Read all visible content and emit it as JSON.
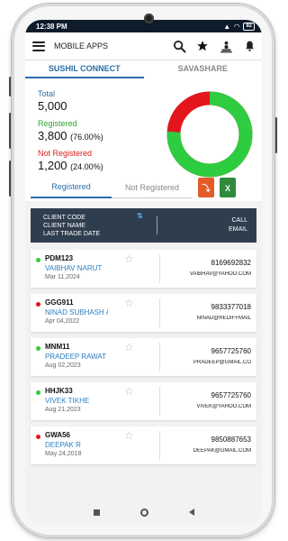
{
  "status": {
    "time": "12:38 PM",
    "battery": "92"
  },
  "app": {
    "title": "MOBILE APPS"
  },
  "icons": [
    "menu-icon",
    "search-icon",
    "star-icon",
    "trophy-icon",
    "bell-icon"
  ],
  "tabs": [
    {
      "label": "SUSHIL CONNECT",
      "active": true
    },
    {
      "label": "SAVASHARE",
      "active": false
    }
  ],
  "summary": {
    "total_label": "Total",
    "total": "5,000",
    "registered_label": "Registered",
    "registered": "3,800",
    "registered_pct": "(76.00%)",
    "not_registered_label": "Not Registered",
    "not_registered": "1,200",
    "not_registered_pct": "(24.00%)",
    "registered_fraction": 0.76
  },
  "colors": {
    "registered": "#2ecc40",
    "not_registered": "#e3161d",
    "accent": "#2a6ea8",
    "header": "#2f3e4e"
  },
  "filters": {
    "registered": "Registered",
    "not_registered": "Not Registered"
  },
  "table": {
    "head_left": [
      "CLIENT CODE",
      "CLIENT NAME",
      "LAST TRADE DATE"
    ],
    "head_right": [
      "CALL",
      "EMAIL"
    ]
  },
  "clients": [
    {
      "code": "PDM123",
      "name": "VAIBHAV NARUT",
      "date": "Mar 11,2024",
      "phone": "8169692832",
      "email": "VAIBHAV@YAHOO.COM",
      "status": "registered"
    },
    {
      "code": "GGG911",
      "name": "NINAD SUBHASH AT",
      "date": "Apr 04,2022",
      "phone": "9833377018",
      "email": "NINAD@REDIFFMAIL",
      "status": "not_registered"
    },
    {
      "code": "MNM11",
      "name": "PRADEEP RAWAT",
      "date": "Aug 02,2023",
      "phone": "9657725760",
      "email": "PRADEEP@GMAIL.CO",
      "status": "registered"
    },
    {
      "code": "HHJK33",
      "name": "VIVEK TIKHE",
      "date": "Aug 21,2023",
      "phone": "9657725760",
      "email": "VIVEK@YAHOO.COM",
      "status": "registered"
    },
    {
      "code": "GWA56",
      "name": "DEEPAK R",
      "date": "May 24,2018",
      "phone": "9850887653",
      "email": "DEEPAK@GMAIL.COM",
      "status": "not_registered"
    }
  ]
}
